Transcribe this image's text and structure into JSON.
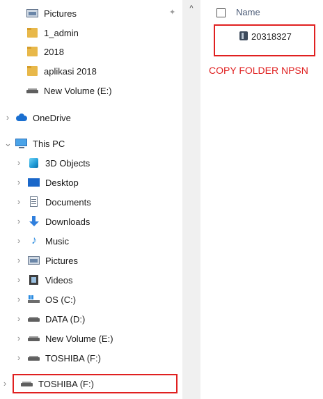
{
  "nav": {
    "quick_access": [
      {
        "id": "pictures",
        "label": "Pictures",
        "icon": "pictures-icon",
        "pinned": true
      },
      {
        "id": "1-admin",
        "label": "1_admin",
        "icon": "folder-icon"
      },
      {
        "id": "2018",
        "label": "2018",
        "icon": "folder-icon"
      },
      {
        "id": "aplikasi-2018",
        "label": "aplikasi 2018",
        "icon": "folder-icon"
      },
      {
        "id": "new-volume-e-quick",
        "label": "New Volume (E:)",
        "icon": "drive-icon"
      }
    ],
    "onedrive": {
      "label": "OneDrive",
      "icon": "onedrive-icon",
      "expanded": false
    },
    "this_pc": {
      "label": "This PC",
      "icon": "pc-icon",
      "expanded": true,
      "children": [
        {
          "id": "3d-objects",
          "label": "3D Objects",
          "icon": "3d-objects-icon"
        },
        {
          "id": "desktop",
          "label": "Desktop",
          "icon": "desktop-icon"
        },
        {
          "id": "documents",
          "label": "Documents",
          "icon": "documents-icon"
        },
        {
          "id": "downloads",
          "label": "Downloads",
          "icon": "downloads-icon"
        },
        {
          "id": "music",
          "label": "Music",
          "icon": "music-icon",
          "glyph": "♪"
        },
        {
          "id": "pictures",
          "label": "Pictures",
          "icon": "pictures-icon"
        },
        {
          "id": "videos",
          "label": "Videos",
          "icon": "videos-icon"
        },
        {
          "id": "os-c",
          "label": "OS (C:)",
          "icon": "os-drive-icon"
        },
        {
          "id": "data-d",
          "label": "DATA (D:)",
          "icon": "drive-icon"
        },
        {
          "id": "new-volume-e",
          "label": "New Volume (E:)",
          "icon": "drive-icon"
        },
        {
          "id": "toshiba-f",
          "label": "TOSHIBA (F:)",
          "icon": "drive-icon"
        }
      ]
    },
    "toshiba_root": {
      "label": "TOSHIBA (F:)",
      "icon": "drive-icon",
      "highlighted": true
    }
  },
  "content": {
    "column_header": "Name",
    "files": [
      {
        "name": "20318327",
        "icon": "file-icon",
        "highlighted": true
      }
    ],
    "annotation": "COPY FOLDER NPSN"
  },
  "glyphs": {
    "chevron_right": "›",
    "chevron_down": "⌄",
    "scroll_up": "^",
    "pin": "📌"
  },
  "colors": {
    "annotation_red": "#e02020",
    "header_text": "#4a5a76",
    "folder": "#e8b84a"
  }
}
